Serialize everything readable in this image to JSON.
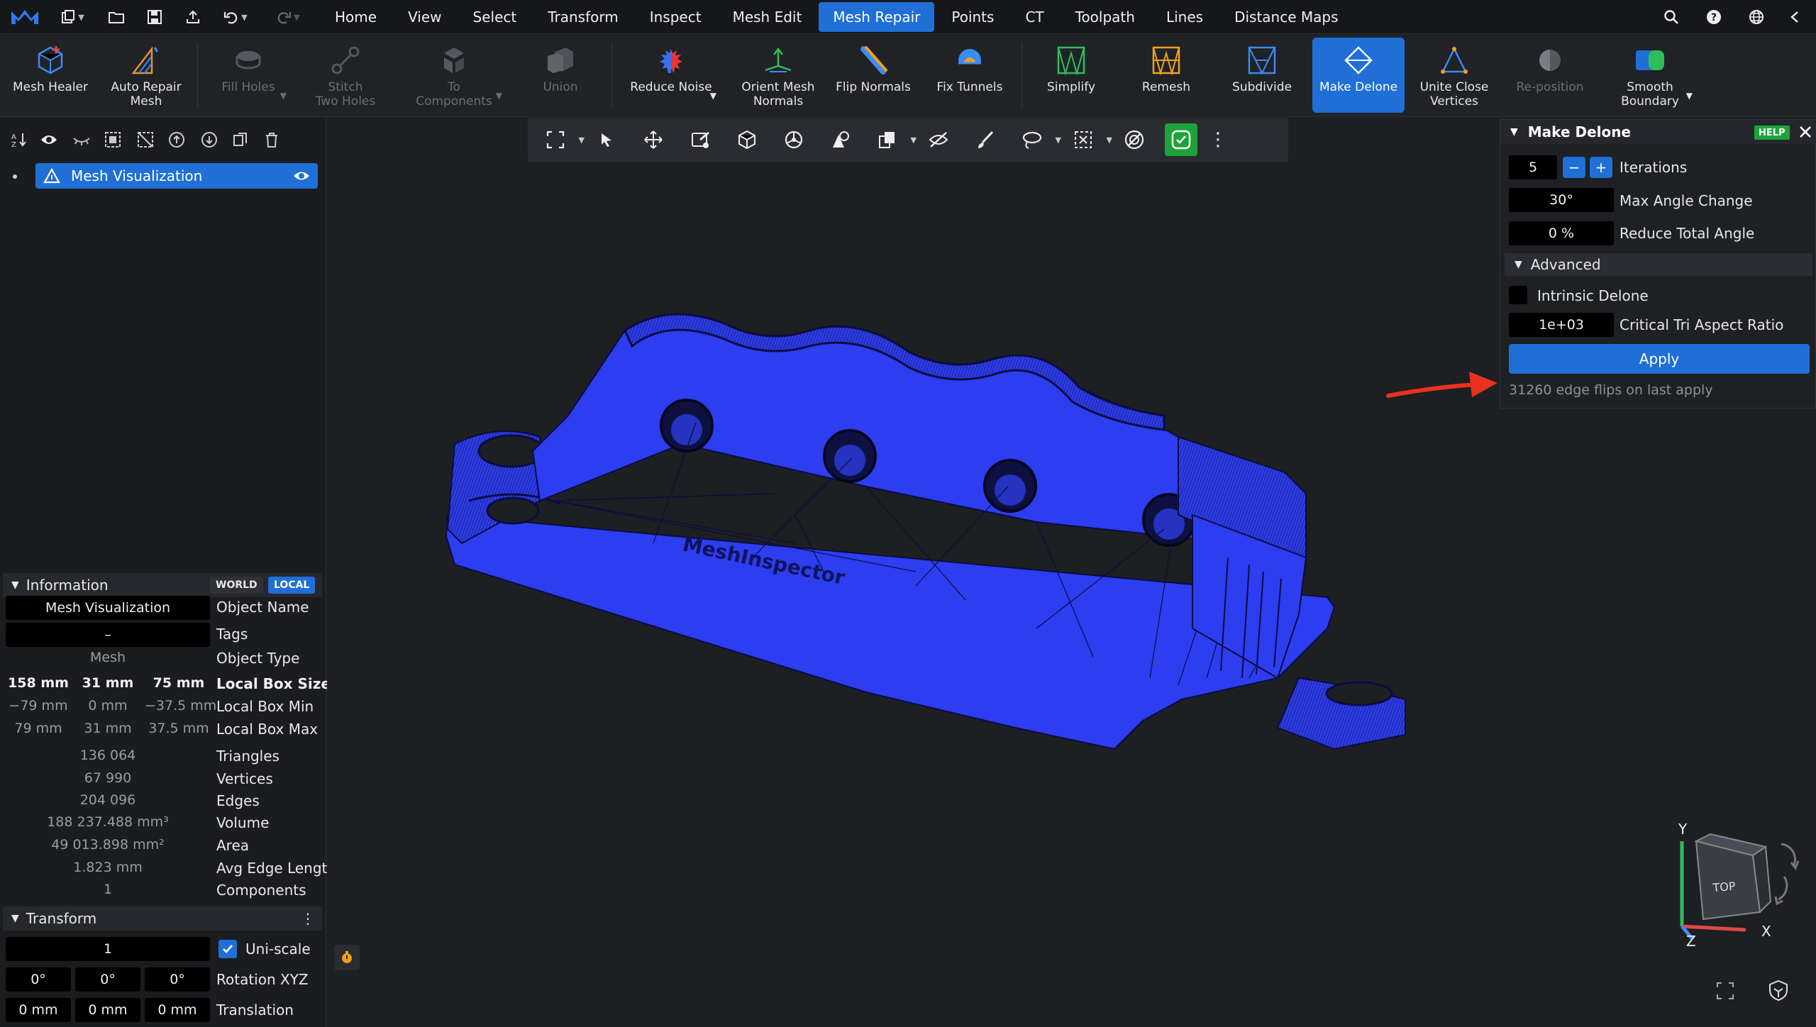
{
  "menubar": {
    "tabs": [
      "Home",
      "View",
      "Select",
      "Transform",
      "Inspect",
      "Mesh Edit",
      "Mesh Repair",
      "Points",
      "CT",
      "Toolpath",
      "Lines",
      "Distance Maps"
    ],
    "active_tab": "Mesh Repair"
  },
  "ribbon": {
    "tools": [
      {
        "label": "Mesh Healer",
        "state": "normal"
      },
      {
        "label": "Auto Repair\nMesh",
        "state": "normal"
      },
      {
        "label": "Fill Holes",
        "state": "disabled"
      },
      {
        "label": "Stitch\nTwo Holes",
        "state": "disabled"
      },
      {
        "label": "To\nComponents",
        "state": "disabled"
      },
      {
        "label": "Union",
        "state": "disabled"
      },
      {
        "label": "Reduce Noise",
        "state": "normal"
      },
      {
        "label": "Orient Mesh\nNormals",
        "state": "normal"
      },
      {
        "label": "Flip Normals",
        "state": "normal"
      },
      {
        "label": "Fix Tunnels",
        "state": "normal"
      },
      {
        "label": "Simplify",
        "state": "normal"
      },
      {
        "label": "Remesh",
        "state": "normal"
      },
      {
        "label": "Subdivide",
        "state": "normal"
      },
      {
        "label": "Make Delone",
        "state": "active"
      },
      {
        "label": "Unite Close\nVertices",
        "state": "normal"
      },
      {
        "label": "Re-position",
        "state": "disabled"
      },
      {
        "label": "Smooth\nBoundary",
        "state": "normal"
      }
    ]
  },
  "scene": {
    "object_name": "Mesh Visualization"
  },
  "info": {
    "header": "Information",
    "world": "WORLD",
    "local": "LOCAL",
    "object_name_value": "Mesh Visualization",
    "object_name_label": "Object Name",
    "tags_value": "–",
    "tags_label": "Tags",
    "object_type_value": "Mesh",
    "object_type_label": "Object Type",
    "box_size": [
      "158 mm",
      "31 mm",
      "75 mm"
    ],
    "box_size_label": "Local Box Size",
    "box_min": [
      "−79 mm",
      "0 mm",
      "−37.5 mm"
    ],
    "box_min_label": "Local Box Min",
    "box_max": [
      "79 mm",
      "31 mm",
      "37.5 mm"
    ],
    "box_max_label": "Local Box Max",
    "triangles": "136 064",
    "triangles_label": "Triangles",
    "vertices": "67 990",
    "vertices_label": "Vertices",
    "edges": "204 096",
    "edges_label": "Edges",
    "volume": "188 237.488 mm³",
    "volume_label": "Volume",
    "area": "49 013.898 mm²",
    "area_label": "Area",
    "avg_edge": "1.823 mm",
    "avg_edge_label": "Avg Edge Length",
    "components": "1",
    "components_label": "Components"
  },
  "transform": {
    "header": "Transform",
    "scale": "1",
    "uniscale_label": "Uni-scale",
    "uniscale_checked": true,
    "rotation": [
      "0°",
      "0°",
      "0°"
    ],
    "rotation_label": "Rotation XYZ",
    "translation": [
      "0 mm",
      "0 mm",
      "0 mm"
    ],
    "translation_label": "Translation"
  },
  "dialog": {
    "title": "Make Delone",
    "help": "HELP",
    "iterations_value": "5",
    "iterations_label": "Iterations",
    "max_angle_value": "30°",
    "max_angle_label": "Max Angle Change",
    "reduce_angle_value": "0 %",
    "reduce_angle_label": "Reduce Total Angle",
    "advanced_label": "Advanced",
    "intrinsic_label": "Intrinsic Delone",
    "critical_value": "1e+03",
    "critical_label": "Critical Tri Aspect Ratio",
    "apply_label": "Apply",
    "status": "31260 edge flips on last apply"
  },
  "axis_cube": {
    "top_label": "TOP",
    "x": "X",
    "y": "Y",
    "z": "Z"
  },
  "colors": {
    "accent": "#1f6fd6",
    "mesh": "#2d3df0",
    "help": "#1da33a",
    "arrow": "#e8321e"
  }
}
